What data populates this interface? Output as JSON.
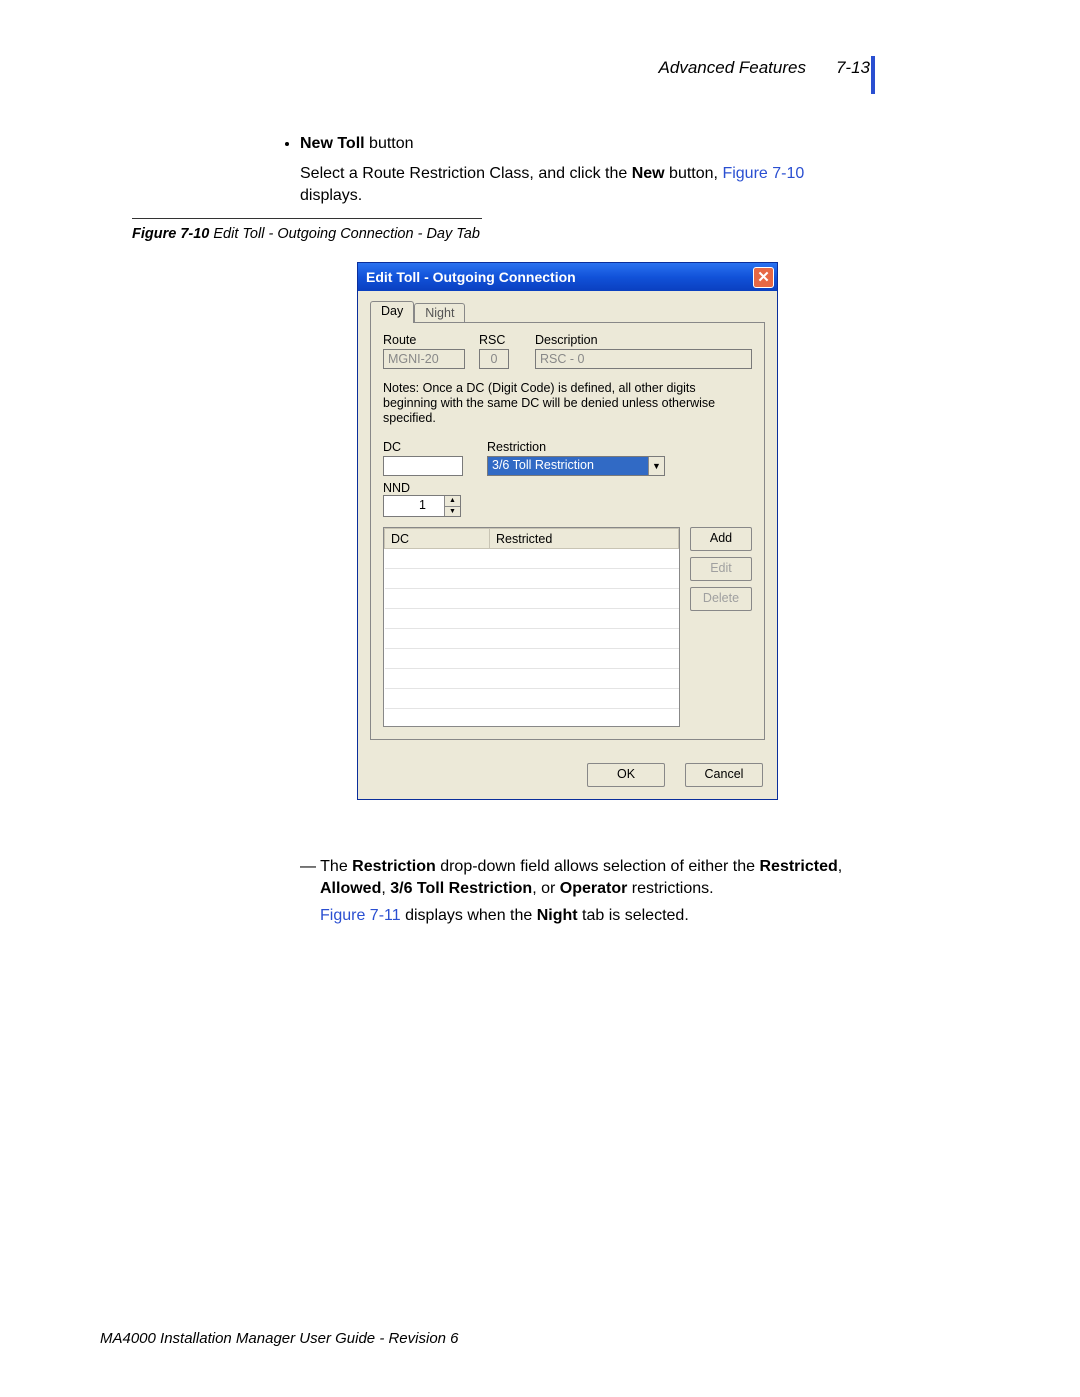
{
  "header": {
    "title": "Advanced Features",
    "page_no": "7-13"
  },
  "bullet1": {
    "bold": "New Toll",
    "rest": " button"
  },
  "para1": {
    "text_a": "Select a Route Restriction Class, and click the ",
    "bold": "New",
    "text_b": " button, ",
    "xref": "Figure 7-10",
    "text_c": " displays."
  },
  "fig_caption": {
    "label": "Figure 7-10",
    "desc": "  Edit Toll - Outgoing Connection - Day Tab"
  },
  "dialog": {
    "title": "Edit Toll - Outgoing Connection",
    "tabs": {
      "day": "Day",
      "night": "Night"
    },
    "labels": {
      "route": "Route",
      "rsc": "RSC",
      "description": "Description",
      "dc": "DC",
      "restriction": "Restriction",
      "nnd": "NND"
    },
    "fields": {
      "route": "MGNI-20",
      "rsc": "0",
      "description": "RSC - 0",
      "dc_value": "",
      "restriction_selected": "3/6 Toll Restriction",
      "nnd_value": "1"
    },
    "notes": "Notes: Once a DC (Digit Code) is defined, all other digits beginning with the same DC will be denied unless otherwise specified.",
    "list": {
      "headers": {
        "dc": "DC",
        "restricted": "Restricted"
      }
    },
    "buttons": {
      "add": "Add",
      "edit": "Edit",
      "delete": "Delete",
      "ok": "OK",
      "cancel": "Cancel"
    }
  },
  "lower": {
    "dash": "—",
    "a1": " The ",
    "b1": "Restriction",
    "a2": " drop-down field allows selection of either the ",
    "b2": "Restricted",
    "a3": ", ",
    "b3": "Allowed",
    "a4": ", ",
    "b4": "3/6 Toll Restriction",
    "a5": ", or ",
    "b5": "Operator",
    "a6": " restrictions.",
    "xref2": "Figure 7-11",
    "p2a": " displays when the ",
    "p2b": "Night",
    "p2c": " tab is selected."
  },
  "footer": "MA4000 Installation Manager User Guide - Revision 6"
}
